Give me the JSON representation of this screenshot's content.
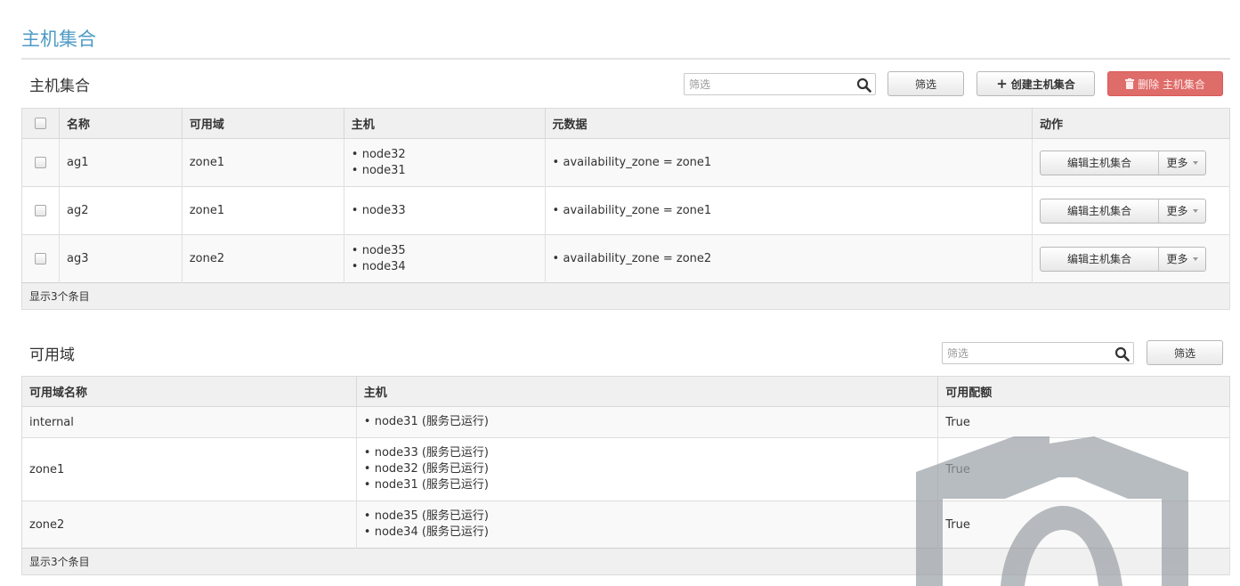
{
  "page": {
    "title": "主机集合"
  },
  "aggregates": {
    "title": "主机集合",
    "filter_placeholder": "筛选",
    "filter_button": "筛选",
    "create_button": "创建主机集合",
    "delete_button": "删除 主机集合",
    "columns": [
      "名称",
      "可用域",
      "主机",
      "元数据",
      "动作"
    ],
    "rows": [
      {
        "name": "ag1",
        "zone": "zone1",
        "hosts": [
          "node32",
          "node31"
        ],
        "metadata": [
          "availability_zone = zone1"
        ],
        "edit": "编辑主机集合",
        "more": "更多"
      },
      {
        "name": "ag2",
        "zone": "zone1",
        "hosts": [
          "node33"
        ],
        "metadata": [
          "availability_zone = zone1"
        ],
        "edit": "编辑主机集合",
        "more": "更多"
      },
      {
        "name": "ag3",
        "zone": "zone2",
        "hosts": [
          "node35",
          "node34"
        ],
        "metadata": [
          "availability_zone = zone2"
        ],
        "edit": "编辑主机集合",
        "more": "更多"
      }
    ],
    "footer": "显示3个条目"
  },
  "zones": {
    "title": "可用域",
    "filter_placeholder": "筛选",
    "filter_button": "筛选",
    "columns": [
      "可用域名称",
      "主机",
      "可用配额"
    ],
    "rows": [
      {
        "name": "internal",
        "hosts": [
          "node31 (服务已运行)"
        ],
        "available": "True"
      },
      {
        "name": "zone1",
        "hosts": [
          "node33 (服务已运行)",
          "node32 (服务已运行)",
          "node31 (服务已运行)"
        ],
        "available": "True"
      },
      {
        "name": "zone2",
        "hosts": [
          "node35 (服务已运行)",
          "node34 (服务已运行)"
        ],
        "available": "True"
      }
    ],
    "footer": "显示3个条目"
  },
  "colors": {
    "title": "#4d9ac5",
    "danger": "#d9534f",
    "header_bg": "#f0f0f0"
  },
  "icons": {
    "search": "search-icon",
    "plus": "plus-icon",
    "trash": "trash-icon",
    "caret": "caret-down-icon"
  }
}
